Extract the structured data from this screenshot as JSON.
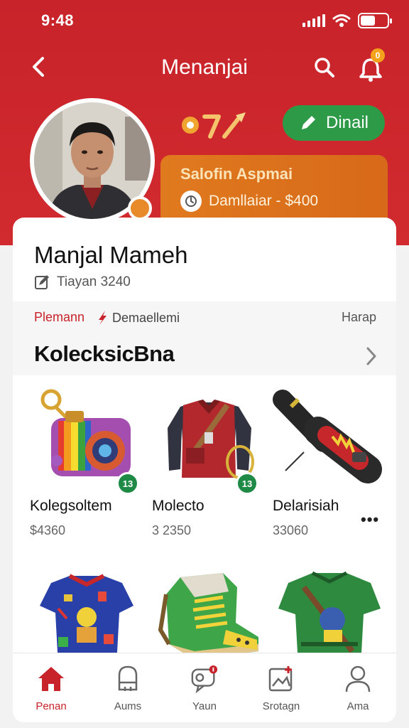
{
  "status_bar": {
    "time": "9:48",
    "icons": [
      "signal-icon",
      "wifi-icon",
      "battery-icon"
    ],
    "battery_level": 0.55
  },
  "header": {
    "title": "Menanjai",
    "notification_count": "0"
  },
  "profile": {
    "name": "Manjal Mameh",
    "subtitle": "Tiayan 3240",
    "edit_label": "Dinail",
    "promo_title": "Salofin Aspmai",
    "promo_value": "Damllaiar - $400"
  },
  "tags": {
    "primary": "Plemann",
    "secondary": "Demaellemi",
    "right": "Harap"
  },
  "section": {
    "title": "KolecksicBna"
  },
  "items": [
    {
      "name": "Kolegsoltem",
      "price": "$4360",
      "badge": "13",
      "icon": "toy-camera-icon"
    },
    {
      "name": "Molecto",
      "price": "3 2350",
      "badge": "13",
      "icon": "vest-icon"
    },
    {
      "name": "Delarisiah",
      "price": "33060",
      "badge": "",
      "icon": "microphone-icon"
    },
    {
      "name": "",
      "price": "",
      "badge": "",
      "icon": "jersey-icon"
    },
    {
      "name": "",
      "price": "",
      "badge": "",
      "icon": "sneaker-icon"
    },
    {
      "name": "",
      "price": "",
      "badge": "",
      "icon": "tshirt-icon"
    }
  ],
  "more_label": "•••",
  "tabs": [
    {
      "label": "Penan",
      "icon": "home-icon",
      "active": true
    },
    {
      "label": "Aums",
      "icon": "bag-icon",
      "active": false
    },
    {
      "label": "Yaun",
      "icon": "chat-icon",
      "active": false
    },
    {
      "label": "Srotagn",
      "icon": "gallery-icon",
      "active": false
    },
    {
      "label": "Ama",
      "icon": "person-icon",
      "active": false
    }
  ],
  "colors": {
    "brand_red": "#c8232a",
    "accent_orange": "#e07a1e",
    "accent_green": "#2d9a47"
  }
}
